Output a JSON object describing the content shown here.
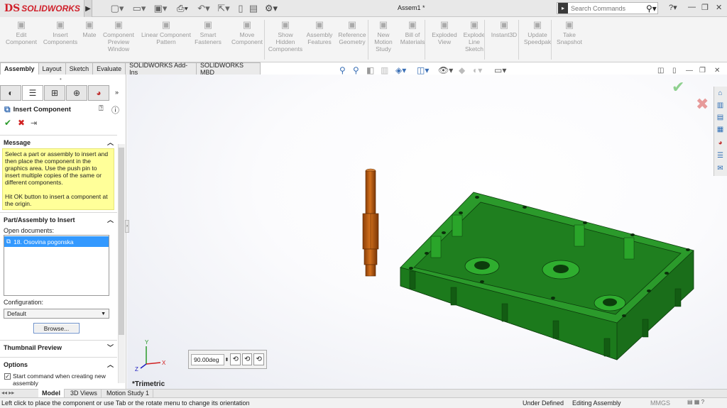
{
  "app": {
    "brand_ds": "DS",
    "brand_name": "SOLIDWORKS",
    "doc_title": "Assem1 *"
  },
  "search": {
    "placeholder": "Search Commands"
  },
  "command_manager": [
    {
      "label": "Edit\nComponent",
      "icon": "edit-component-icon"
    },
    {
      "label": "Insert\nComponents",
      "icon": "insert-components-icon"
    },
    {
      "label": "Mate",
      "icon": "mate-icon"
    },
    {
      "label": "Component\nPreview\nWindow",
      "icon": "preview-window-icon"
    },
    {
      "label": "Linear Component\nPattern",
      "icon": "linear-pattern-icon"
    },
    {
      "label": "Smart\nFasteners",
      "icon": "fasteners-icon"
    },
    {
      "label": "Move\nComponent",
      "icon": "move-component-icon"
    },
    {
      "label": "Show\nHidden\nComponents",
      "icon": "show-hidden-icon"
    },
    {
      "label": "Assembly\nFeatures",
      "icon": "assembly-features-icon"
    },
    {
      "label": "Reference\nGeometry",
      "icon": "reference-geometry-icon"
    },
    {
      "label": "New\nMotion\nStudy",
      "icon": "motion-study-icon"
    },
    {
      "label": "Bill of\nMaterials",
      "icon": "bom-icon"
    },
    {
      "label": "Exploded\nView",
      "icon": "exploded-view-icon"
    },
    {
      "label": "Explode\nLine\nSketch",
      "icon": "explode-line-icon"
    },
    {
      "label": "Instant3D",
      "icon": "instant3d-icon"
    },
    {
      "label": "Update\nSpeedpak",
      "icon": "speedpak-icon"
    },
    {
      "label": "Take\nSnapshot",
      "icon": "snapshot-icon"
    }
  ],
  "tabs": [
    "Assembly",
    "Layout",
    "Sketch",
    "Evaluate",
    "SOLIDWORKS Add-Ins",
    "SOLIDWORKS MBD"
  ],
  "property_manager": {
    "title": "Insert Component",
    "message_header": "Message",
    "message_p1": "Select a part or assembly to insert and then place the component in the graphics area. Use the push pin to insert multiple copies of the same or different components.",
    "message_p2": "Hit OK button to insert a component at the origin.",
    "part_header": "Part/Assembly to Insert",
    "open_docs_label": "Open documents:",
    "open_docs": [
      "18. Osovina pogonska"
    ],
    "config_label": "Configuration:",
    "config_value": "Default",
    "browse_label": "Browse...",
    "thumbnail_header": "Thumbnail Preview",
    "options_header": "Options",
    "start_cmd_label": "Start command when creating new assembly"
  },
  "viewport": {
    "view_label": "*Trimetric",
    "rotate_value": "90.00deg",
    "triad_x": "X",
    "triad_y": "Y",
    "triad_z": "Z"
  },
  "bottom_tabs": [
    "Model",
    "3D Views",
    "Motion Study 1"
  ],
  "status": {
    "hint": "Left click to place the component or use Tab or the rotate menu to change its orientation",
    "defined": "Under Defined",
    "mode": "Editing Assembly",
    "units": "MMGS"
  },
  "colors": {
    "part_green": "#1f8a1f",
    "shaft_orange": "#c86414",
    "accent_blue": "#3399ff",
    "message_yellow": "#ffff99"
  }
}
